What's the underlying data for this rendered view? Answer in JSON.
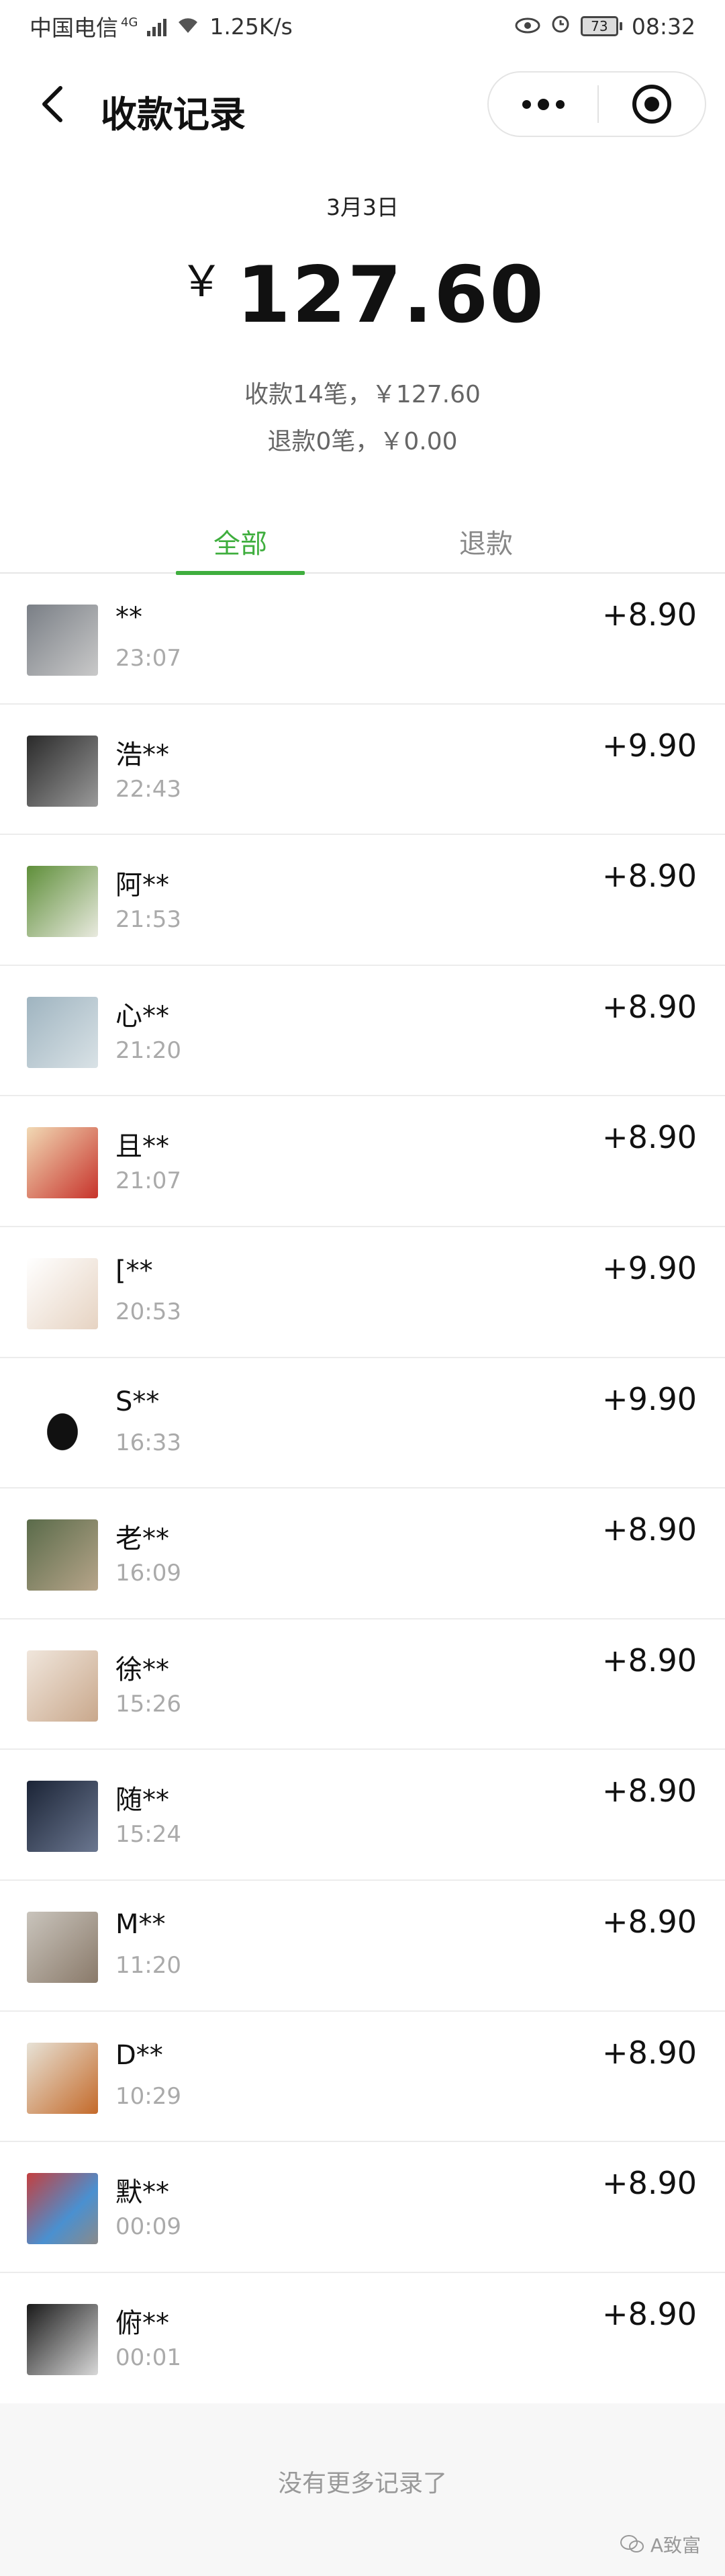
{
  "status_bar": {
    "carrier": "中国电信",
    "network_type": "4G",
    "speed": "1.25K/s",
    "battery": "73",
    "time": "08:32"
  },
  "header": {
    "title": "收款记录"
  },
  "summary": {
    "date": "3月3日",
    "currency_symbol": "￥",
    "total": "127.60",
    "received_line": "收款14笔，￥127.60",
    "refund_line": "退款0笔，￥0.00"
  },
  "tabs": [
    {
      "label": "全部",
      "active": true
    },
    {
      "label": "退款",
      "active": false
    }
  ],
  "records": [
    {
      "name": "**",
      "time": "23:07",
      "amount": "+8.90"
    },
    {
      "name": "浩**",
      "time": "22:43",
      "amount": "+9.90"
    },
    {
      "name": "阿**",
      "time": "21:53",
      "amount": "+8.90"
    },
    {
      "name": "心**",
      "time": "21:20",
      "amount": "+8.90"
    },
    {
      "name": "且**",
      "time": "21:07",
      "amount": "+8.90"
    },
    {
      "name": "[**",
      "time": "20:53",
      "amount": "+9.90"
    },
    {
      "name": "S**",
      "time": "16:33",
      "amount": "+9.90"
    },
    {
      "name": "老**",
      "time": "16:09",
      "amount": "+8.90"
    },
    {
      "name": "徐**",
      "time": "15:26",
      "amount": "+8.90"
    },
    {
      "name": "随**",
      "time": "15:24",
      "amount": "+8.90"
    },
    {
      "name": "M**",
      "time": "11:20",
      "amount": "+8.90"
    },
    {
      "name": "D**",
      "time": "10:29",
      "amount": "+8.90"
    },
    {
      "name": "默**",
      "time": "00:09",
      "amount": "+8.90"
    },
    {
      "name": "俯**",
      "time": "00:01",
      "amount": "+8.90"
    }
  ],
  "footer": {
    "no_more": "没有更多记录了",
    "watermark": "A致富"
  },
  "colors": {
    "accent": "#3fae3e",
    "text_primary": "#111111",
    "text_secondary": "#999999"
  }
}
